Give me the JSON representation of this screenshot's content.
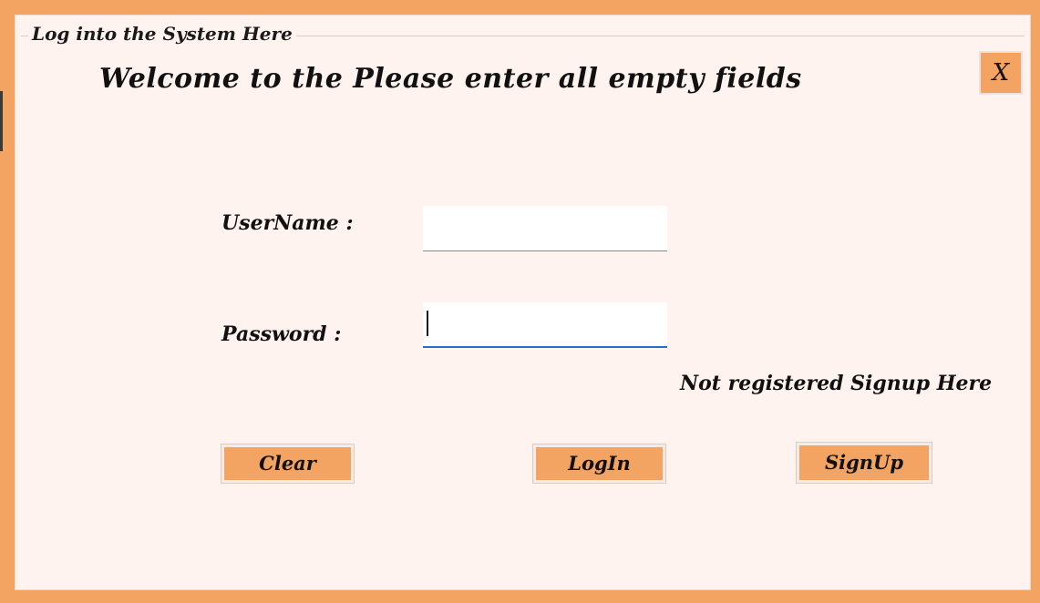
{
  "window": {
    "group_title": "Log into the System Here",
    "welcome_text": "Welcome to the Please enter all empty fields",
    "close_label": "X"
  },
  "form": {
    "username_label": "UserName :",
    "username_value": "",
    "password_label": "Password :",
    "password_value": ""
  },
  "links": {
    "signup_prompt": "Not registered Signup Here"
  },
  "buttons": {
    "clear_label": "Clear",
    "login_label": "LogIn",
    "signup_label": "SignUp"
  },
  "colors": {
    "accent": "#f4a462",
    "panel": "#fef3ee",
    "focus": "#2070c8"
  }
}
